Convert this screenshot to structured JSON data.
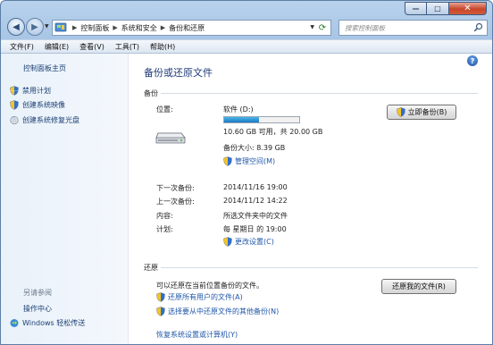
{
  "window": {
    "caption_buttons": {
      "minimize": "—",
      "maximize": "□",
      "close": "✕"
    }
  },
  "address_bar": {
    "breadcrumbs": [
      "控制面板",
      "系统和安全",
      "备份和还原"
    ],
    "search_placeholder": "搜索控制面板"
  },
  "menu": [
    "文件(F)",
    "编辑(E)",
    "查看(V)",
    "工具(T)",
    "帮助(H)"
  ],
  "left_pane": {
    "home": "控制面板主页",
    "links": [
      "禁用计划",
      "创建系统映像",
      "创建系统修复光盘"
    ],
    "see_also_title": "另请参阅",
    "see_also": [
      "操作中心",
      "Windows 轻松传送"
    ]
  },
  "main": {
    "title": "备份或还原文件",
    "backup": {
      "section_title": "备份",
      "location_label": "位置:",
      "drive_name": "软件 (D:)",
      "space_text": "10.60 GB 可用，共 20.00 GB",
      "used_fraction": 0.47,
      "backup_size": "备份大小: 8.39 GB",
      "manage_space": "管理空间(M)",
      "backup_now": "立即备份(B)",
      "next_label": "下一次备份:",
      "next_value": "2014/11/16 19:00",
      "last_label": "上一次备份:",
      "last_value": "2014/11/12 14:22",
      "contents_label": "内容:",
      "contents_value": "所选文件夹中的文件",
      "schedule_label": "计划:",
      "schedule_value": "每 星期日 的 19:00",
      "change_settings": "更改设置(C)"
    },
    "restore": {
      "section_title": "还原",
      "description": "可以还原在当前位置备份的文件。",
      "restore_my_files": "还原我的文件(R)",
      "restore_all_users": "还原所有用户的文件(A)",
      "select_other_backup": "选择要从中还原文件的其他备份(N)",
      "recover_system": "恢复系统设置或计算机(Y)"
    }
  },
  "colors": {
    "link": "#1f57a8",
    "title": "#1e3a78",
    "progress": "#2a8bd2",
    "frame": "#a9c6e6"
  }
}
